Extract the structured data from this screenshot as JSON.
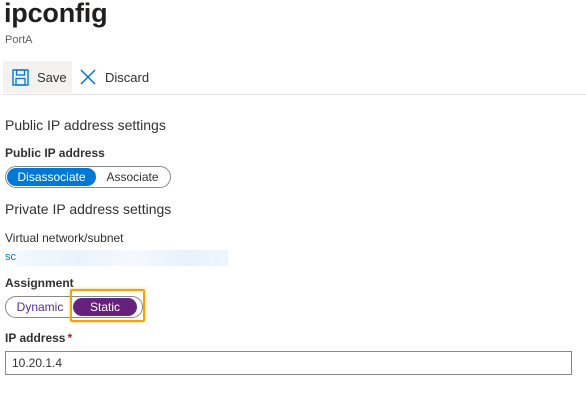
{
  "header": {
    "title": "ipconfig",
    "subtitle": "PortA"
  },
  "toolbar": {
    "save_label": "Save",
    "save_icon": "save-icon",
    "discard_label": "Discard",
    "discard_icon": "close-icon"
  },
  "public_ip": {
    "section_title": "Public IP address settings",
    "field_label": "Public IP address",
    "options": [
      "Disassociate",
      "Associate"
    ],
    "selected": "Disassociate"
  },
  "private_ip": {
    "section_title": "Private IP address settings",
    "vnet_label": "Virtual network/subnet",
    "vnet_value": "sc"
  },
  "assignment": {
    "label": "Assignment",
    "options": [
      "Dynamic",
      "Static"
    ],
    "selected": "Static"
  },
  "ip_address": {
    "label": "IP address",
    "required_mark": "*",
    "value": "10.20.1.4"
  },
  "colors": {
    "accent": "#0078d4",
    "selected_toggle": "#68217a",
    "highlight": "#f0a30a",
    "required": "#a4262c"
  }
}
